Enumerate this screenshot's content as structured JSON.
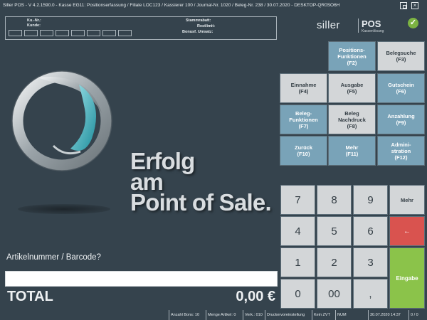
{
  "titlebar": {
    "text": "Siller POS - V 4.2.1590.0 - Kasse EG11: Positionserfassung / Filiale LOC123 / Kassierer 100 / Journal-Nr. 1020 / Beleg-Nr. 238 / 30.07.2020  -  DESKTOP-QR0SO6H"
  },
  "info": {
    "ku_nr_label": "Ku.-Nr.:",
    "kunde_label": "Kunde:",
    "stammrabatt_label": "Stammrabatt:",
    "restlimit_label": "Restlimit:",
    "bonusf_label": "Bonusf. Umsatz:"
  },
  "brand": {
    "name": "siller",
    "product": "POS",
    "tagline": "Kassenlösung"
  },
  "slogan": {
    "line1": "Erfolg",
    "line2": "am",
    "line3": "Point of Sale."
  },
  "input": {
    "prompt": "Artikelnummer / Barcode?",
    "value": "",
    "placeholder": ""
  },
  "total": {
    "label": "TOTAL",
    "amount": "0,00 €"
  },
  "function_keys": [
    {
      "label": "Positions-\nFunktionen\n(F2)",
      "style": "blue"
    },
    {
      "label": "Belegsuche\n(F3)",
      "style": "grey"
    },
    {
      "label": "Einnahme\n(F4)",
      "style": "grey"
    },
    {
      "label": "Ausgabe\n(F5)",
      "style": "grey"
    },
    {
      "label": "Gutschein\n(F6)",
      "style": "blue"
    },
    {
      "label": "Beleg-\nFunktionen\n(F7)",
      "style": "blue"
    },
    {
      "label": "Beleg\nNachdruck\n(F8)",
      "style": "grey"
    },
    {
      "label": "Anzahlung\n(F9)",
      "style": "blue"
    },
    {
      "label": "Zurück\n(F10)",
      "style": "blue"
    },
    {
      "label": "Mehr\n(F11)",
      "style": "blue"
    },
    {
      "label": "Admini-\nstration\n(F12)",
      "style": "blue"
    }
  ],
  "keypad": {
    "k7": "7",
    "k8": "8",
    "k9": "9",
    "mehr": "Mehr",
    "k4": "4",
    "k5": "5",
    "k6": "6",
    "backspace": "←",
    "k1": "1",
    "k2": "2",
    "k3": "3",
    "enter": "Eingabe",
    "k0": "0",
    "k00": "00",
    "comma": ","
  },
  "status": {
    "bons": "Anzahl Bons: 10",
    "menge": "Menge Artikel: 0",
    "verk": "Verk.: 010",
    "drucker": "Druckervoreinstellung",
    "zvt": "Kein ZVT",
    "num": "NUM",
    "datetime": "30.07.2020 14:37",
    "pages": "0 / 0"
  },
  "colors": {
    "background": "#35434d",
    "key_blue": "#79a3b8",
    "key_grey": "#d3d6d8",
    "backspace": "#d9534f",
    "enter": "#8bc34a"
  }
}
